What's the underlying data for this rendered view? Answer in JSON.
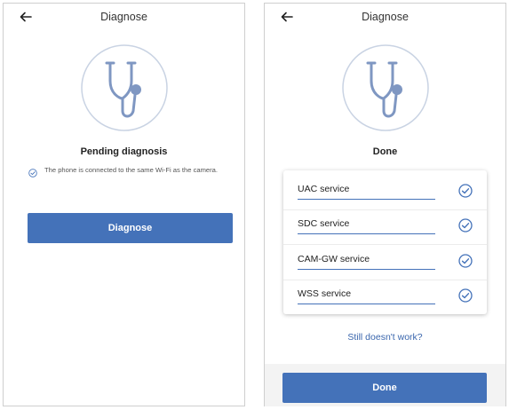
{
  "colors": {
    "accent": "#4472b9",
    "icon_line": "#7f97c2",
    "icon_circle": "#c9d3e3"
  },
  "left_screen": {
    "back_icon": "arrow-left-icon",
    "title": "Diagnose",
    "hero_icon": "stethoscope-icon",
    "status": "Pending diagnosis",
    "note_icon": "check-circle-icon",
    "note_text": "The phone is connected to the same Wi-Fi as the camera.",
    "button_label": "Diagnose"
  },
  "right_screen": {
    "back_icon": "arrow-left-icon",
    "title": "Diagnose",
    "hero_icon": "stethoscope-icon",
    "status": "Done",
    "services": [
      {
        "name": "UAC service",
        "status_icon": "check-circle-icon"
      },
      {
        "name": "SDC service",
        "status_icon": "check-circle-icon"
      },
      {
        "name": "CAM-GW service",
        "status_icon": "check-circle-icon"
      },
      {
        "name": "WSS service",
        "status_icon": "check-circle-icon"
      }
    ],
    "help_link": "Still doesn't work?",
    "button_label": "Done"
  }
}
